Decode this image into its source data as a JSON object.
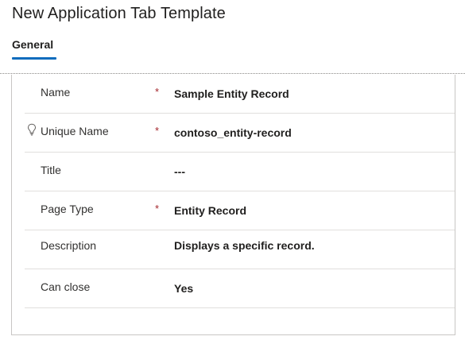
{
  "page": {
    "title": "New Application Tab Template"
  },
  "tabs": [
    {
      "label": "General",
      "selected": true
    }
  ],
  "colors": {
    "tab_accent": "#0f6cbd",
    "required_marker": "#a4262c",
    "divider": "#e1dfdd"
  },
  "form": {
    "required_marker": "*",
    "fields": [
      {
        "label": "Name",
        "required": true,
        "value": "Sample Entity Record"
      },
      {
        "label": "Unique Name",
        "required": true,
        "value": "contoso_entity-record",
        "icon": "lightbulb-icon"
      },
      {
        "label": "Title",
        "required": false,
        "value": "---"
      },
      {
        "label": "Page Type",
        "required": true,
        "value": "Entity Record"
      },
      {
        "label": "Description",
        "required": false,
        "value": "Displays a specific record."
      },
      {
        "label": "Can close",
        "required": false,
        "value": "Yes"
      }
    ]
  }
}
